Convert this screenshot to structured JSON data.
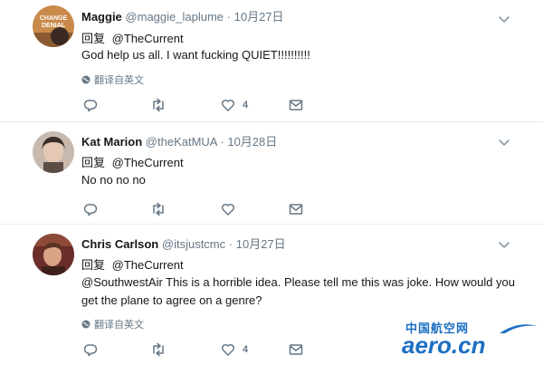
{
  "tweets": [
    {
      "name": "Maggie",
      "handle": "@maggie_laplume",
      "separator": "·",
      "date": "10月27日",
      "reply_label": "回复",
      "reply_to": "@TheCurrent",
      "text": "God help us all. I want fucking QUIET!!!!!!!!!!",
      "translate_label": "翻译自英文",
      "like_count": "4",
      "avatar_text": "CHANGE DENIAL"
    },
    {
      "name": "Kat Marion",
      "handle": "@theKatMUA",
      "separator": "·",
      "date": "10月28日",
      "reply_label": "回复",
      "reply_to": "@TheCurrent",
      "text": "No no no no"
    },
    {
      "name": "Chris Carlson",
      "handle": "@itsjustcmc",
      "separator": "·",
      "date": "10月27日",
      "reply_label": "回复",
      "reply_to": "@TheCurrent",
      "text": "@SouthwestAir  This is a horrible idea.  Please tell me this was joke.  How would you get the plane to agree on a genre?",
      "translate_label": "翻译自英文",
      "like_count": "4"
    }
  ],
  "watermark": {
    "cn": "中国航空网",
    "en": "aero.cn"
  },
  "icons": {
    "reply": "reply-icon",
    "retweet": "retweet-icon",
    "like": "heart-icon",
    "dm": "envelope-icon",
    "caret": "chevron-down-icon",
    "globe": "globe-icon"
  },
  "colors": {
    "name": "#14171a",
    "secondary": "#657786",
    "divider": "#e6ecf0",
    "watermark": "#1d6fc2"
  }
}
